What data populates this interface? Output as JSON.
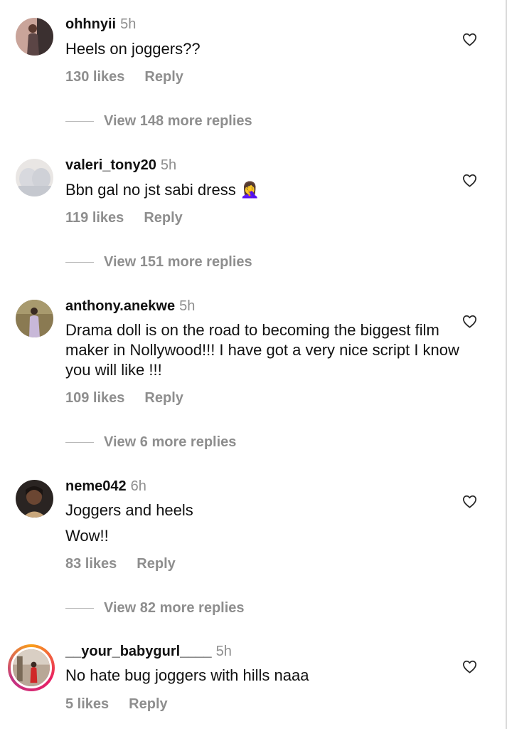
{
  "comments": [
    {
      "username": "ohhnyii",
      "time": "5h",
      "lines": [
        "Heels on joggers??"
      ],
      "likes": "130 likes",
      "reply_label": "Reply",
      "view_replies": "View 148 more replies",
      "avatar_icon": "user-photo-avatar"
    },
    {
      "username": "valeri_tony20",
      "time": "5h",
      "lines": [
        "Bbn gal no jst sabi dress 🤦‍♀️"
      ],
      "likes": "119 likes",
      "reply_label": "Reply",
      "view_replies": "View 151 more replies",
      "avatar_icon": "user-photo-avatar"
    },
    {
      "username": "anthony.anekwe",
      "time": "5h",
      "lines": [
        "Drama doll is on the road to becoming the biggest film maker in Nollywood!!! I have got a very nice script I know you will like !!!"
      ],
      "likes": "109 likes",
      "reply_label": "Reply",
      "view_replies": "View 6 more replies",
      "avatar_icon": "user-photo-avatar"
    },
    {
      "username": "neme042",
      "time": "6h",
      "lines": [
        "Joggers and heels",
        "Wow!!"
      ],
      "likes": "83 likes",
      "reply_label": "Reply",
      "view_replies": "View 82 more replies",
      "avatar_icon": "user-photo-avatar"
    },
    {
      "username": "__your_babygurl____",
      "time": "5h",
      "lines": [
        "No hate bug joggers with hills naaa"
      ],
      "likes": "5 likes",
      "reply_label": "Reply",
      "view_replies": "",
      "avatar_icon": "story-ring-avatar"
    }
  ],
  "colors": {
    "muted_text": "#8e8e8e",
    "primary_text": "#111111",
    "story_ring": [
      "#f9a01b",
      "#e91e63",
      "#c13584"
    ]
  },
  "icons": {
    "like": "heart-outline-icon"
  }
}
